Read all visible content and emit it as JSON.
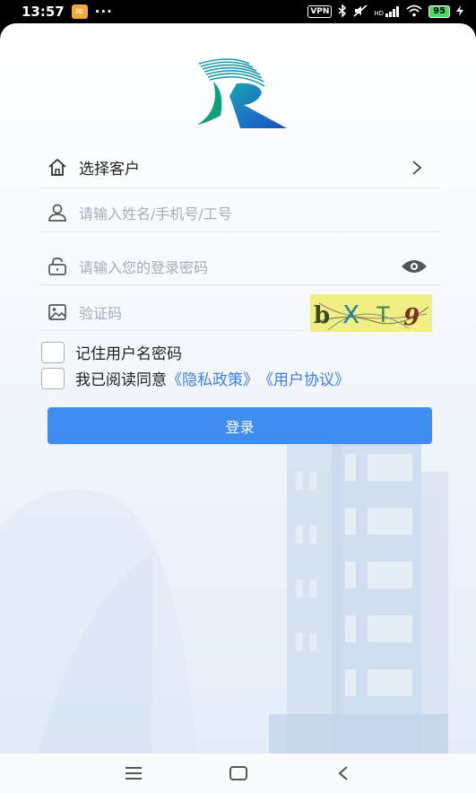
{
  "status_bar": {
    "time": "13:57",
    "dots": "···",
    "vpn": "VPN",
    "network": "HD",
    "battery": "95"
  },
  "form": {
    "customer_label": "选择客户",
    "username_placeholder": "请输入姓名/手机号/工号",
    "password_placeholder": "请输入您的登录密码",
    "captcha_placeholder": "验证码",
    "captcha_text": [
      "b",
      "X",
      "T",
      "9"
    ]
  },
  "options": {
    "remember_label": "记住用户名密码",
    "agree_prefix": "我已阅读同意",
    "privacy_link": "《隐私政策》",
    "user_agreement_link": "《用户协议》"
  },
  "actions": {
    "login_label": "登录"
  },
  "colors": {
    "accent": "#3f8df0",
    "link": "#3d7ee6",
    "captcha_bg": "#f1ee86"
  },
  "icons": {
    "customer": "home-icon",
    "user": "user-icon",
    "password": "lock-icon",
    "captcha": "image-icon",
    "toggle_password": "eye-icon",
    "chevron": "chevron-right-icon"
  }
}
